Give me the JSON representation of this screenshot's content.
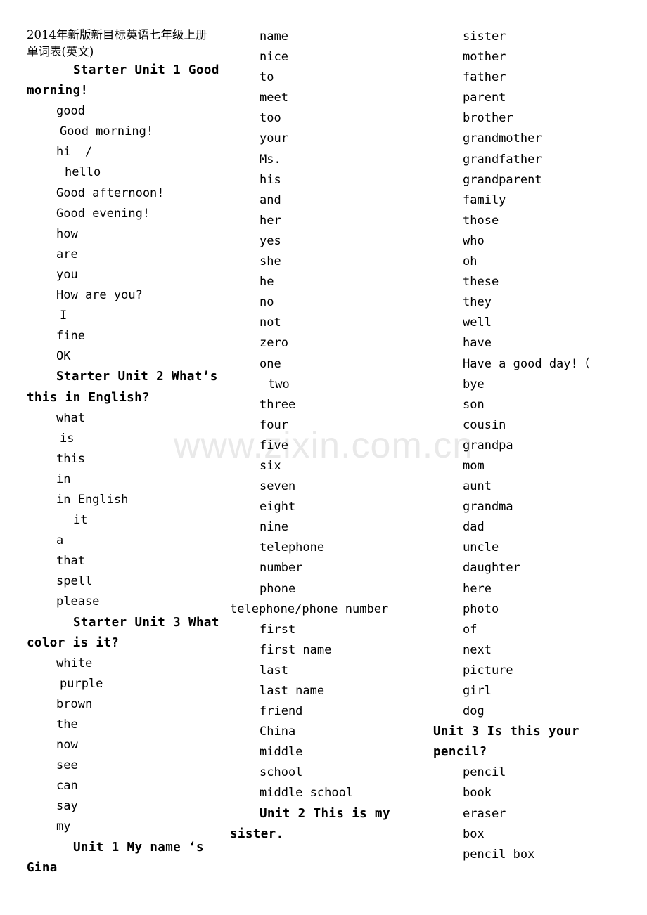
{
  "document": {
    "header_line_1": "2014年新版新目标英语七年级上册",
    "header_line_2": "单词表(英文)",
    "watermark": "www.zixin.com.cn"
  },
  "columns": [
    {
      "name": "column-1",
      "lines": [
        {
          "text": "Starter Unit 1 Good morning!",
          "type": "heading",
          "indent": "hang-1"
        },
        {
          "text": "good",
          "type": "entry",
          "indent": "ind-1"
        },
        {
          "text": "Good morning!",
          "type": "entry",
          "indent": "ind-2"
        },
        {
          "text": "hi  /",
          "type": "entry",
          "indent": "ind-1"
        },
        {
          "text": "hello",
          "type": "entry",
          "indent": "ind-3"
        },
        {
          "text": "Good afternoon!",
          "type": "entry",
          "indent": "ind-1"
        },
        {
          "text": "Good evening!",
          "type": "entry",
          "indent": "ind-1"
        },
        {
          "text": "how",
          "type": "entry",
          "indent": "ind-1"
        },
        {
          "text": "are",
          "type": "entry",
          "indent": "ind-1"
        },
        {
          "text": "you",
          "type": "entry",
          "indent": "ind-1"
        },
        {
          "text": "How are you?",
          "type": "entry",
          "indent": "ind-1"
        },
        {
          "text": "I",
          "type": "entry",
          "indent": "ind-2"
        },
        {
          "text": "fine",
          "type": "entry",
          "indent": "ind-1"
        },
        {
          "text": "OK",
          "type": "entry",
          "indent": "ind-1"
        },
        {
          "text": "Starter Unit 2 What’s this in English?",
          "type": "heading",
          "indent": "hang-2"
        },
        {
          "text": "what",
          "type": "entry",
          "indent": "ind-1"
        },
        {
          "text": "is",
          "type": "entry",
          "indent": "ind-2"
        },
        {
          "text": "this",
          "type": "entry",
          "indent": "ind-1"
        },
        {
          "text": "in",
          "type": "entry",
          "indent": "ind-1"
        },
        {
          "text": "in English",
          "type": "entry",
          "indent": "ind-1"
        },
        {
          "text": "it",
          "type": "entry",
          "indent": "ind-4"
        },
        {
          "text": "a",
          "type": "entry",
          "indent": "ind-1"
        },
        {
          "text": "that",
          "type": "entry",
          "indent": "ind-1"
        },
        {
          "text": "spell",
          "type": "entry",
          "indent": "ind-1"
        },
        {
          "text": "please",
          "type": "entry",
          "indent": "ind-1"
        },
        {
          "text": "Starter Unit 3 What color is it?",
          "type": "heading",
          "indent": "hang-1"
        },
        {
          "text": "white",
          "type": "entry",
          "indent": "ind-1"
        },
        {
          "text": "purple",
          "type": "entry",
          "indent": "ind-2"
        },
        {
          "text": "brown",
          "type": "entry",
          "indent": "ind-1"
        },
        {
          "text": "the",
          "type": "entry",
          "indent": "ind-1"
        },
        {
          "text": "now",
          "type": "entry",
          "indent": "ind-1"
        },
        {
          "text": "see",
          "type": "entry",
          "indent": "ind-1"
        },
        {
          "text": "can",
          "type": "entry",
          "indent": "ind-1"
        },
        {
          "text": "say",
          "type": "entry",
          "indent": "ind-1"
        },
        {
          "text": "my",
          "type": "entry",
          "indent": "ind-1"
        },
        {
          "text": "Unit 1 My name ‘s Gina",
          "type": "heading",
          "indent": "hang-1"
        }
      ]
    },
    {
      "name": "column-2",
      "lines": [
        {
          "text": "name",
          "type": "entry",
          "indent": "ind-1"
        },
        {
          "text": "nice",
          "type": "entry",
          "indent": "ind-1"
        },
        {
          "text": "to",
          "type": "entry",
          "indent": "ind-1"
        },
        {
          "text": "meet",
          "type": "entry",
          "indent": "ind-1"
        },
        {
          "text": "too",
          "type": "entry",
          "indent": "ind-1"
        },
        {
          "text": "your",
          "type": "entry",
          "indent": "ind-1"
        },
        {
          "text": "Ms.",
          "type": "entry",
          "indent": "ind-1"
        },
        {
          "text": "his",
          "type": "entry",
          "indent": "ind-1"
        },
        {
          "text": "and",
          "type": "entry",
          "indent": "ind-1"
        },
        {
          "text": "her",
          "type": "entry",
          "indent": "ind-1"
        },
        {
          "text": "yes",
          "type": "entry",
          "indent": "ind-1"
        },
        {
          "text": "she",
          "type": "entry",
          "indent": "ind-1"
        },
        {
          "text": "he",
          "type": "entry",
          "indent": "ind-1"
        },
        {
          "text": "no",
          "type": "entry",
          "indent": "ind-1"
        },
        {
          "text": "not",
          "type": "entry",
          "indent": "ind-1"
        },
        {
          "text": "zero",
          "type": "entry",
          "indent": "ind-1"
        },
        {
          "text": "one",
          "type": "entry",
          "indent": "ind-1"
        },
        {
          "text": "two",
          "type": "entry",
          "indent": "ind-3"
        },
        {
          "text": "three",
          "type": "entry",
          "indent": "ind-1"
        },
        {
          "text": "four",
          "type": "entry",
          "indent": "ind-1"
        },
        {
          "text": "five",
          "type": "entry",
          "indent": "ind-1"
        },
        {
          "text": "six",
          "type": "entry",
          "indent": "ind-1"
        },
        {
          "text": "seven",
          "type": "entry",
          "indent": "ind-1"
        },
        {
          "text": "eight",
          "type": "entry",
          "indent": "ind-1"
        },
        {
          "text": "nine",
          "type": "entry",
          "indent": "ind-1"
        },
        {
          "text": "telephone",
          "type": "entry",
          "indent": "ind-1"
        },
        {
          "text": "number",
          "type": "entry",
          "indent": "ind-1"
        },
        {
          "text": "phone",
          "type": "entry",
          "indent": "ind-1"
        },
        {
          "text": "telephone/phone number",
          "type": "heading-normal",
          "indent": "hang-2"
        },
        {
          "text": "first",
          "type": "entry",
          "indent": "ind-1"
        },
        {
          "text": "first name",
          "type": "entry",
          "indent": "ind-1"
        },
        {
          "text": "last",
          "type": "entry",
          "indent": "ind-1"
        },
        {
          "text": "last name",
          "type": "entry",
          "indent": "ind-1"
        },
        {
          "text": "friend",
          "type": "entry",
          "indent": "ind-1"
        },
        {
          "text": "China",
          "type": "entry",
          "indent": "ind-1"
        },
        {
          "text": "middle",
          "type": "entry",
          "indent": "ind-1"
        },
        {
          "text": "school",
          "type": "entry",
          "indent": "ind-1"
        },
        {
          "text": "middle school",
          "type": "entry",
          "indent": "ind-1"
        },
        {
          "text": "Unit 2 This is my sister.",
          "type": "heading",
          "indent": "hang-2"
        }
      ]
    },
    {
      "name": "column-3",
      "lines": [
        {
          "text": "sister",
          "type": "entry",
          "indent": "ind-1"
        },
        {
          "text": "mother",
          "type": "entry",
          "indent": "ind-1"
        },
        {
          "text": "father",
          "type": "entry",
          "indent": "ind-1"
        },
        {
          "text": "parent",
          "type": "entry",
          "indent": "ind-1"
        },
        {
          "text": "brother",
          "type": "entry",
          "indent": "ind-1"
        },
        {
          "text": "grandmother",
          "type": "entry",
          "indent": "ind-1"
        },
        {
          "text": "grandfather",
          "type": "entry",
          "indent": "ind-1"
        },
        {
          "text": "grandparent",
          "type": "entry",
          "indent": "ind-1"
        },
        {
          "text": "family",
          "type": "entry",
          "indent": "ind-1"
        },
        {
          "text": "those",
          "type": "entry",
          "indent": "ind-1"
        },
        {
          "text": "who",
          "type": "entry",
          "indent": "ind-1"
        },
        {
          "text": "oh",
          "type": "entry",
          "indent": "ind-1"
        },
        {
          "text": "these",
          "type": "entry",
          "indent": "ind-1"
        },
        {
          "text": "they",
          "type": "entry",
          "indent": "ind-1"
        },
        {
          "text": "well",
          "type": "entry",
          "indent": "ind-1"
        },
        {
          "text": "have",
          "type": "entry",
          "indent": "ind-1"
        },
        {
          "text": "Have a good day!（",
          "type": "entry",
          "indent": "ind-1"
        },
        {
          "text": "bye",
          "type": "entry",
          "indent": "ind-1"
        },
        {
          "text": "son",
          "type": "entry",
          "indent": "ind-1"
        },
        {
          "text": "cousin",
          "type": "entry",
          "indent": "ind-1"
        },
        {
          "text": "grandpa",
          "type": "entry",
          "indent": "ind-1"
        },
        {
          "text": "mom",
          "type": "entry",
          "indent": "ind-1"
        },
        {
          "text": "aunt",
          "type": "entry",
          "indent": "ind-1"
        },
        {
          "text": "grandma",
          "type": "entry",
          "indent": "ind-1"
        },
        {
          "text": "dad",
          "type": "entry",
          "indent": "ind-1"
        },
        {
          "text": "uncle",
          "type": "entry",
          "indent": "ind-1"
        },
        {
          "text": "daughter",
          "type": "entry",
          "indent": "ind-1"
        },
        {
          "text": "here",
          "type": "entry",
          "indent": "ind-1"
        },
        {
          "text": "photo",
          "type": "entry",
          "indent": "ind-1"
        },
        {
          "text": "of",
          "type": "entry",
          "indent": "ind-1"
        },
        {
          "text": "next",
          "type": "entry",
          "indent": "ind-1"
        },
        {
          "text": "picture",
          "type": "entry",
          "indent": "ind-1"
        },
        {
          "text": "girl",
          "type": "entry",
          "indent": "ind-1"
        },
        {
          "text": "dog",
          "type": "entry",
          "indent": "ind-1"
        },
        {
          "text": "Unit 3 Is this your pencil?",
          "type": "heading",
          "indent": "hang-0"
        },
        {
          "text": "pencil",
          "type": "entry",
          "indent": "ind-1"
        },
        {
          "text": "book",
          "type": "entry",
          "indent": "ind-1"
        },
        {
          "text": "eraser",
          "type": "entry",
          "indent": "ind-1"
        },
        {
          "text": "box",
          "type": "entry",
          "indent": "ind-1"
        },
        {
          "text": "pencil box",
          "type": "entry",
          "indent": "ind-1"
        }
      ]
    }
  ]
}
